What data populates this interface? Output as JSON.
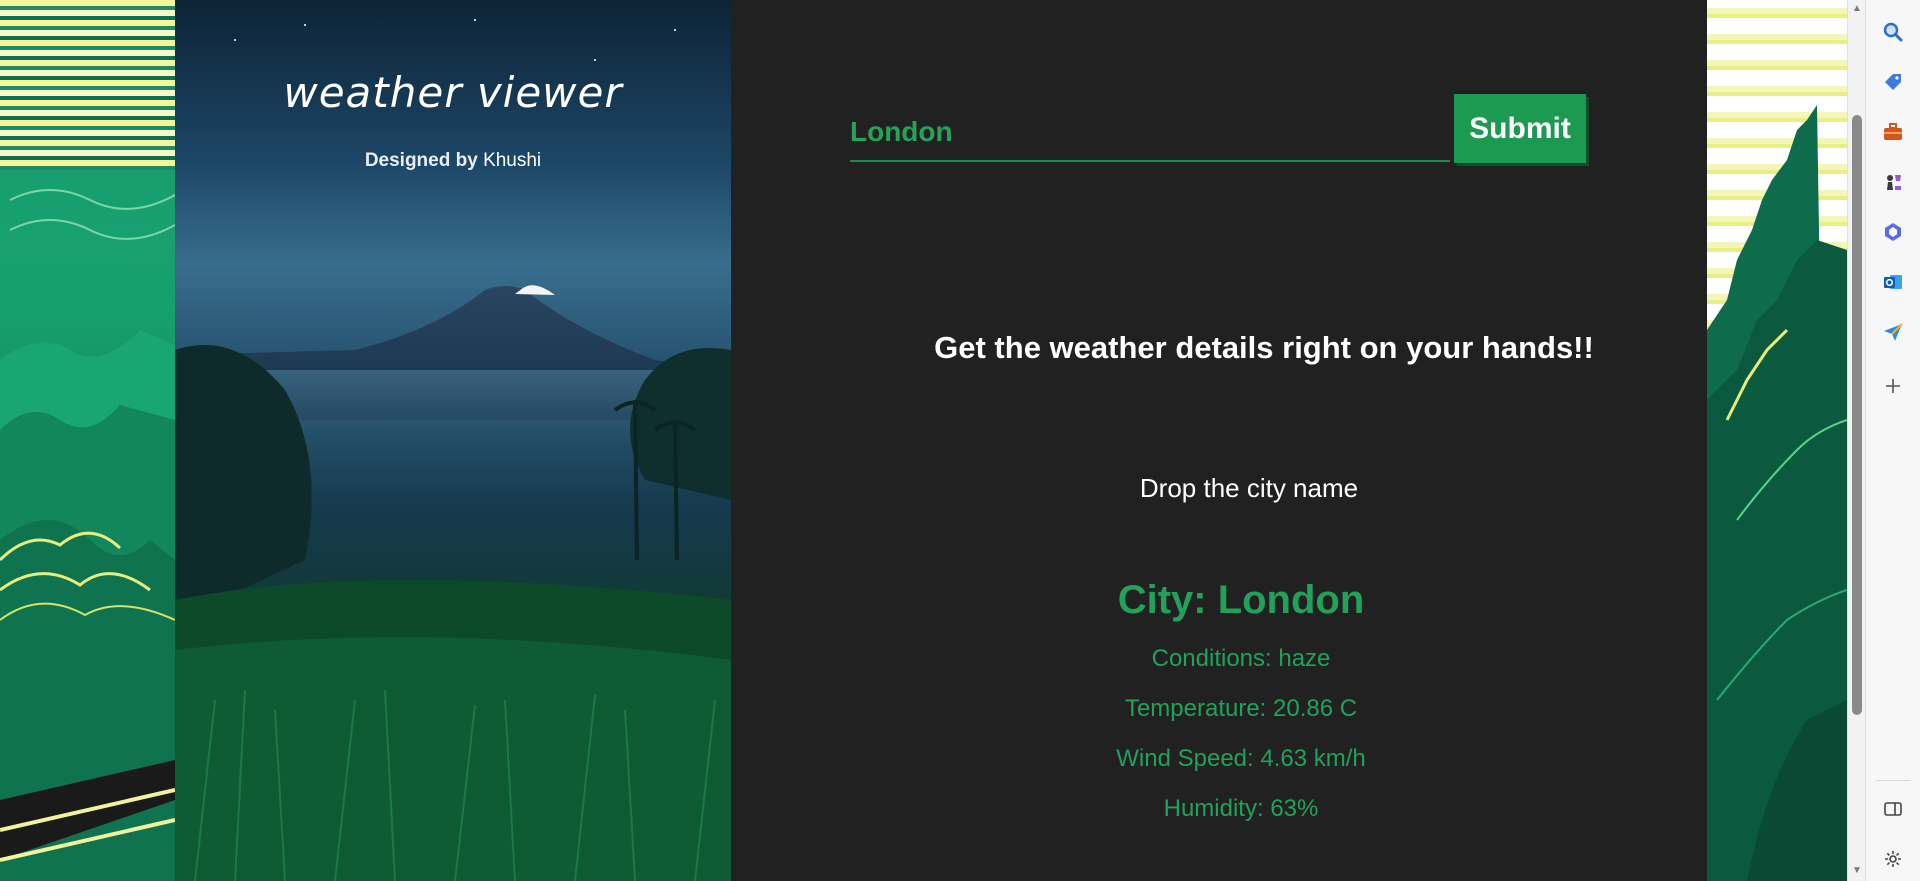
{
  "hero": {
    "title": "weather viewer",
    "designed_by_prefix": "Designed by ",
    "author": "Khushi"
  },
  "search": {
    "city_value": "London",
    "submit_label": "Submit"
  },
  "main": {
    "tagline": "Get the weather details right on your hands!!",
    "prompt": "Drop the city name"
  },
  "weather": {
    "city_label": "City: London",
    "conditions_label": "Conditions: haze",
    "temperature_label": "Temperature: 20.86 C",
    "wind_label": "Wind Speed: 4.63 km/h",
    "humidity_label": "Humidity: 63%"
  },
  "colors": {
    "accent_green": "#1d9a52",
    "text_green": "#22a15a",
    "panel_bg": "#212121"
  },
  "edge_sidebar": {
    "items": [
      {
        "icon": "search-icon"
      },
      {
        "icon": "shopping-tag-icon"
      },
      {
        "icon": "toolbox-icon"
      },
      {
        "icon": "chess-icon"
      },
      {
        "icon": "copilot-icon"
      },
      {
        "icon": "outlook-icon"
      },
      {
        "icon": "send-icon"
      },
      {
        "icon": "add-icon"
      }
    ],
    "bottom_items": [
      {
        "icon": "sidebar-toggle-icon"
      },
      {
        "icon": "settings-icon"
      }
    ]
  }
}
